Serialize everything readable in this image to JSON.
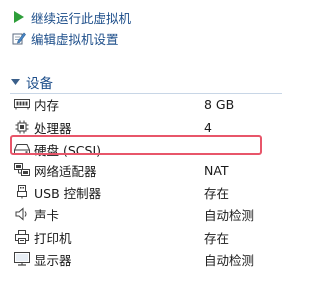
{
  "actions": {
    "power_on_label": "继续运行此虚拟机",
    "edit_settings_label": "编辑虚拟机设置"
  },
  "section": {
    "title": "设备"
  },
  "devices": [
    {
      "name": "内存",
      "value": "8 GB",
      "icon": "memory-icon"
    },
    {
      "name": "处理器",
      "value": "4",
      "icon": "processor-icon"
    },
    {
      "name": "硬盘 (SCSI)",
      "value": "",
      "icon": "hard-disk-icon"
    },
    {
      "name": "网络适配器",
      "value": "NAT",
      "icon": "network-adapter-icon"
    },
    {
      "name": "USB 控制器",
      "value": "存在",
      "icon": "usb-controller-icon"
    },
    {
      "name": "声卡",
      "value": "自动检测",
      "icon": "sound-card-icon"
    },
    {
      "name": "打印机",
      "value": "存在",
      "icon": "printer-icon"
    },
    {
      "name": "显示器",
      "value": "自动检测",
      "icon": "display-icon"
    }
  ],
  "colors": {
    "link": "#1d4e8a",
    "play_green": "#2e9e3a",
    "highlight": "#e8566a"
  }
}
